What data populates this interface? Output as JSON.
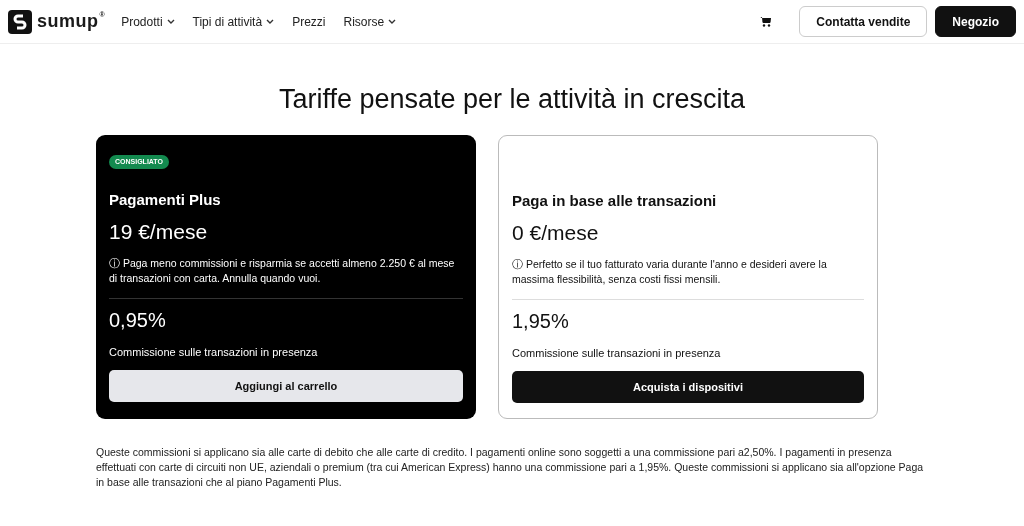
{
  "nav": {
    "logo": "sumup",
    "logo_mark": "®",
    "links": [
      {
        "label": "Prodotti",
        "dropdown": true
      },
      {
        "label": "Tipi di attività",
        "dropdown": true
      },
      {
        "label": "Prezzi",
        "dropdown": false
      },
      {
        "label": "Risorse",
        "dropdown": true
      }
    ],
    "buttons": [
      {
        "label": "Contatta vendite",
        "kind": "outline"
      },
      {
        "label": "Negozio",
        "kind": "filled"
      }
    ]
  },
  "heading": "Tariffe pensate per le attività in crescita",
  "plans": [
    {
      "kind": "dark",
      "badge": "CONSIGLIATO",
      "name": "Pagamenti Plus",
      "price": "19 €/mese",
      "note": "ⓘ Paga meno commissioni e risparmia se accetti almeno 2.250 € al mese di transazioni con carta. Annulla quando vuoi.",
      "rate": "0,95%",
      "rate_label": "Commissione sulle transazioni in presenza",
      "button": "Aggiungi al carrello"
    },
    {
      "kind": "light",
      "name": "Paga in base alle transazioni",
      "price": "0 €/mese",
      "note": "ⓘ Perfetto se il tuo fatturato varia durante l'anno e desideri avere la massima flessibilità, senza costi fissi mensili.",
      "rate": "1,95%",
      "rate_label": "Commissione sulle transazioni in presenza",
      "button": "Acquista i dispositivi"
    }
  ],
  "footnote": "Queste commissioni si applicano sia alle carte di debito che alle carte di credito. I pagamenti online sono soggetti a una commissione pari a2,50%. I pagamenti in presenza effettuati con carte di circuiti non UE, aziendali o premium (tra cui American Express) hanno una commissione pari a 1,95%. Queste commissioni si applicano sia all'opzione Paga in base alle transazioni che al piano Pagamenti Plus."
}
